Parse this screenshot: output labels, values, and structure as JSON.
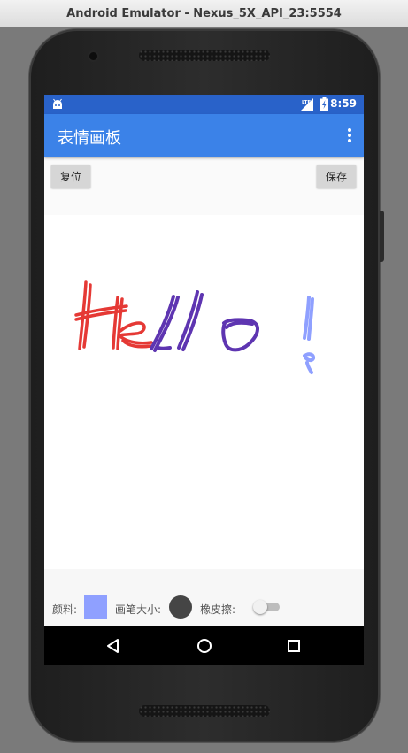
{
  "window": {
    "title": "Android Emulator - Nexus_5X_API_23:5554"
  },
  "statusbar": {
    "time": "8:59",
    "network": "LTE"
  },
  "appbar": {
    "title": "表情画板"
  },
  "toolbar": {
    "reset_label": "复位",
    "save_label": "保存"
  },
  "drawing": {
    "text": "Hello !",
    "colors": {
      "H": "#e53935",
      "e": "#e53935",
      "ll": "#5e35b1",
      "o": "#5e35b1",
      "exclamation": "#8fa0ff"
    }
  },
  "controls": {
    "pigment_label": "颜料:",
    "pigment_color": "#8fa0ff",
    "brush_label": "画笔大小:",
    "brush_color": "#454545",
    "eraser_label": "橡皮擦:",
    "eraser_on": false
  },
  "colors": {
    "appbar": "#3b82e8",
    "statusbar": "#2962c9"
  }
}
